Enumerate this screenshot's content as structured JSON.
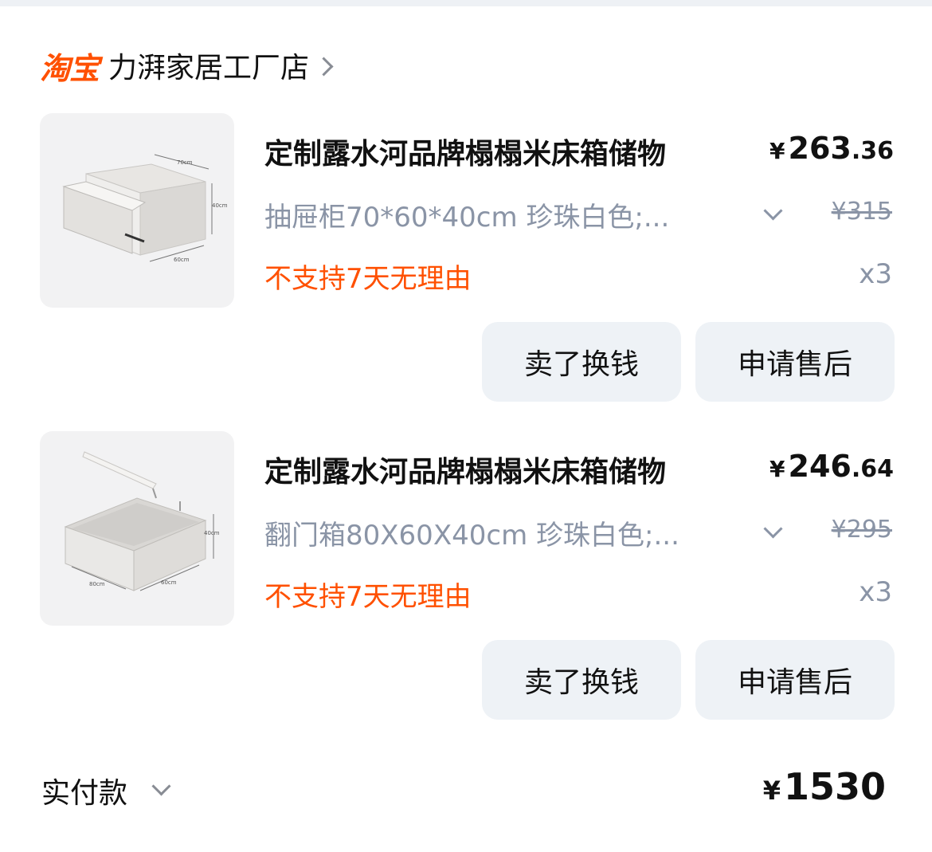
{
  "store": {
    "platform_logo": "淘宝",
    "name": "力湃家居工厂店",
    "chevron_icon": "chevron-right-icon"
  },
  "items": [
    {
      "image_icon": "drawer-cabinet-image",
      "image_labels": [
        "70cm",
        "40cm",
        "60cm"
      ],
      "title": "定制露水河品牌榻榻米床箱储物",
      "price_currency": "¥",
      "price_int": "263",
      "price_dec": ".36",
      "sku": "抽屉柜70*60*40cm 珍珠白色;...",
      "original_price": "¥315",
      "policy": "不支持7天无理由",
      "qty": "x3",
      "sell_label": "卖了换钱",
      "after_sale_label": "申请售后"
    },
    {
      "image_icon": "flip-lid-box-image",
      "image_labels": [
        "40cm",
        "80cm",
        "60cm"
      ],
      "title": "定制露水河品牌榻榻米床箱储物",
      "price_currency": "¥",
      "price_int": "246",
      "price_dec": ".64",
      "sku": "翻门箱80X60X40cm 珍珠白色;...",
      "original_price": "¥295",
      "policy": "不支持7天无理由",
      "qty": "x3",
      "sell_label": "卖了换钱",
      "after_sale_label": "申请售后"
    }
  ],
  "footer": {
    "label": "实付款",
    "currency": "¥",
    "total": "1530"
  },
  "colors": {
    "accent_orange": "#ff5000",
    "muted_text": "#8a94a6",
    "button_bg": "#eef2f6"
  }
}
